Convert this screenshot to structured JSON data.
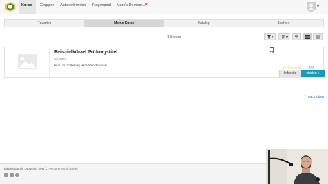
{
  "nav": {
    "items": [
      "Kurse",
      "Gruppen",
      "Autorenbereich",
      "Fragenpool",
      "Marc's Demopr..."
    ],
    "close_icon": "×"
  },
  "tabs": [
    "Favoriten",
    "Meine Kurse",
    "Katalog",
    "Suchen"
  ],
  "list": {
    "count": "1 Eintrag"
  },
  "course": {
    "title": "Beispielkürzel Prüfungstitel",
    "meta": "mit EPIS",
    "description": "Kurs zur Erstellung der Video-Tutorials",
    "rating_stars": "☆☆☆☆☆",
    "comments": "(0)",
    "info_label": "Infoseite",
    "start_label": "starten"
  },
  "to_top": "nach oben",
  "footer": {
    "logged_in": "Eingeloggt als Dozentin, Test",
    "online": "(2 Personen sind online)"
  },
  "colors": {
    "accent": "#1a9bb5",
    "link": "#1f6fb5",
    "close": "#d0312d",
    "star": "#d9a300"
  }
}
